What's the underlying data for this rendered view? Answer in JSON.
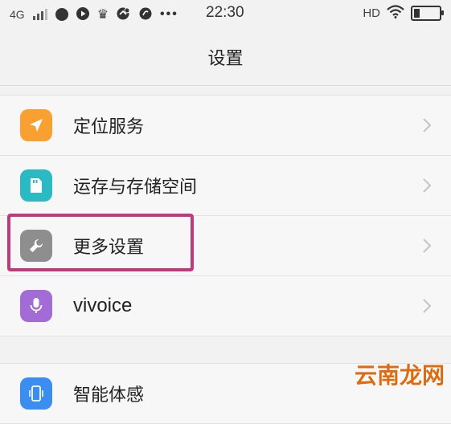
{
  "status_bar": {
    "network": "4G",
    "time": "22:30",
    "hd": "HD",
    "icons": [
      "signal-icon",
      "app-icon",
      "play-icon",
      "crown-icon",
      "game-icon",
      "chat-icon",
      "more-dots-icon",
      "wifi-icon",
      "battery-icon"
    ]
  },
  "header": {
    "title": "设置"
  },
  "settings": [
    {
      "label": "定位服务",
      "icon": "location-icon",
      "color": "#f8a131"
    },
    {
      "label": "运存与存储空间",
      "icon": "sd-card-icon",
      "color": "#2bb9c4"
    },
    {
      "label": "更多设置",
      "icon": "wrench-icon",
      "color": "#8e8e8e",
      "highlighted": true
    },
    {
      "label": "vivoice",
      "icon": "microphone-icon",
      "color": "#a36bd6"
    },
    {
      "label": "智能体感",
      "icon": "phone-motion-icon",
      "color": "#3b8ef0"
    }
  ],
  "highlight_color": "#c0397a",
  "watermark": "云南龙网"
}
